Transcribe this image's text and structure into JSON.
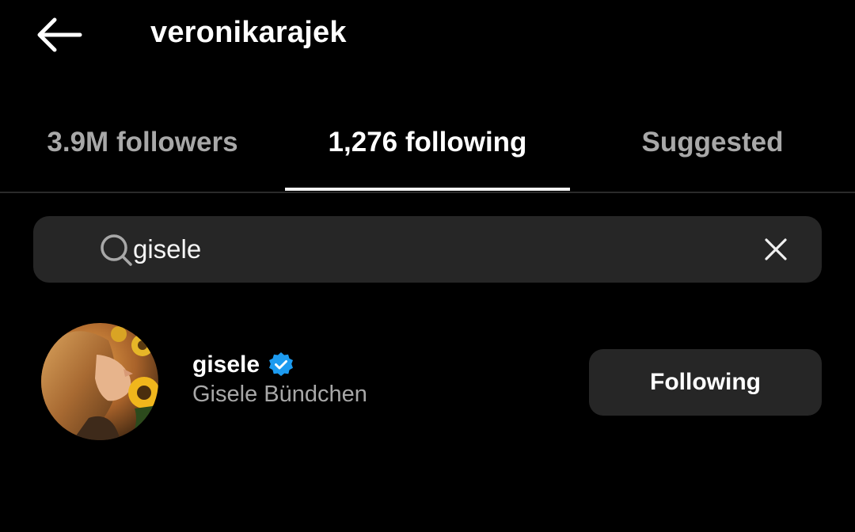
{
  "header": {
    "back_icon": "arrow-left-icon",
    "title": "veronikarajek"
  },
  "tabs": [
    {
      "label": "3.9M followers",
      "active": false
    },
    {
      "label": "1,276 following",
      "active": true
    },
    {
      "label": "Suggested",
      "active": false
    }
  ],
  "search": {
    "icon": "search-icon",
    "value": "gisele",
    "clear_icon": "close-icon"
  },
  "results": [
    {
      "username": "gisele",
      "verified": true,
      "full_name": "Gisele Bündchen",
      "button_label": "Following"
    }
  ],
  "colors": {
    "background": "#000000",
    "surface": "#262626",
    "secondary_text": "#a8a8a8",
    "verified_blue": "#1d9bf0"
  }
}
